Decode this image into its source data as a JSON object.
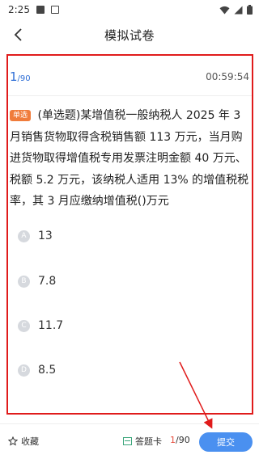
{
  "status_bar": {
    "time": "2:25"
  },
  "header": {
    "title": "模拟试卷"
  },
  "question": {
    "current": "1",
    "total": "/90",
    "timer": "00:59:54",
    "type_badge": "单选",
    "text": "(单选题)某增值税一般纳税人 2025 年 3 月销售货物取得含税销售额 113 万元，当月购进货物取得增值税专用发票注明金额 40 万元、税额 5.2 万元，该纳税人适用 13% 的增值税税率，其 3 月应缴纳增值税()万元",
    "options": [
      {
        "letter": "A",
        "text": "13"
      },
      {
        "letter": "B",
        "text": "7.8"
      },
      {
        "letter": "C",
        "text": "11.7"
      },
      {
        "letter": "D",
        "text": "8.5"
      }
    ]
  },
  "bottom_bar": {
    "favorite_label": "收藏",
    "answer_card_label": "答题卡",
    "progress_current": "1",
    "progress_total": "/90",
    "submit_label": "提交"
  },
  "annotation": {
    "highlight_color": "#e01b1b"
  }
}
